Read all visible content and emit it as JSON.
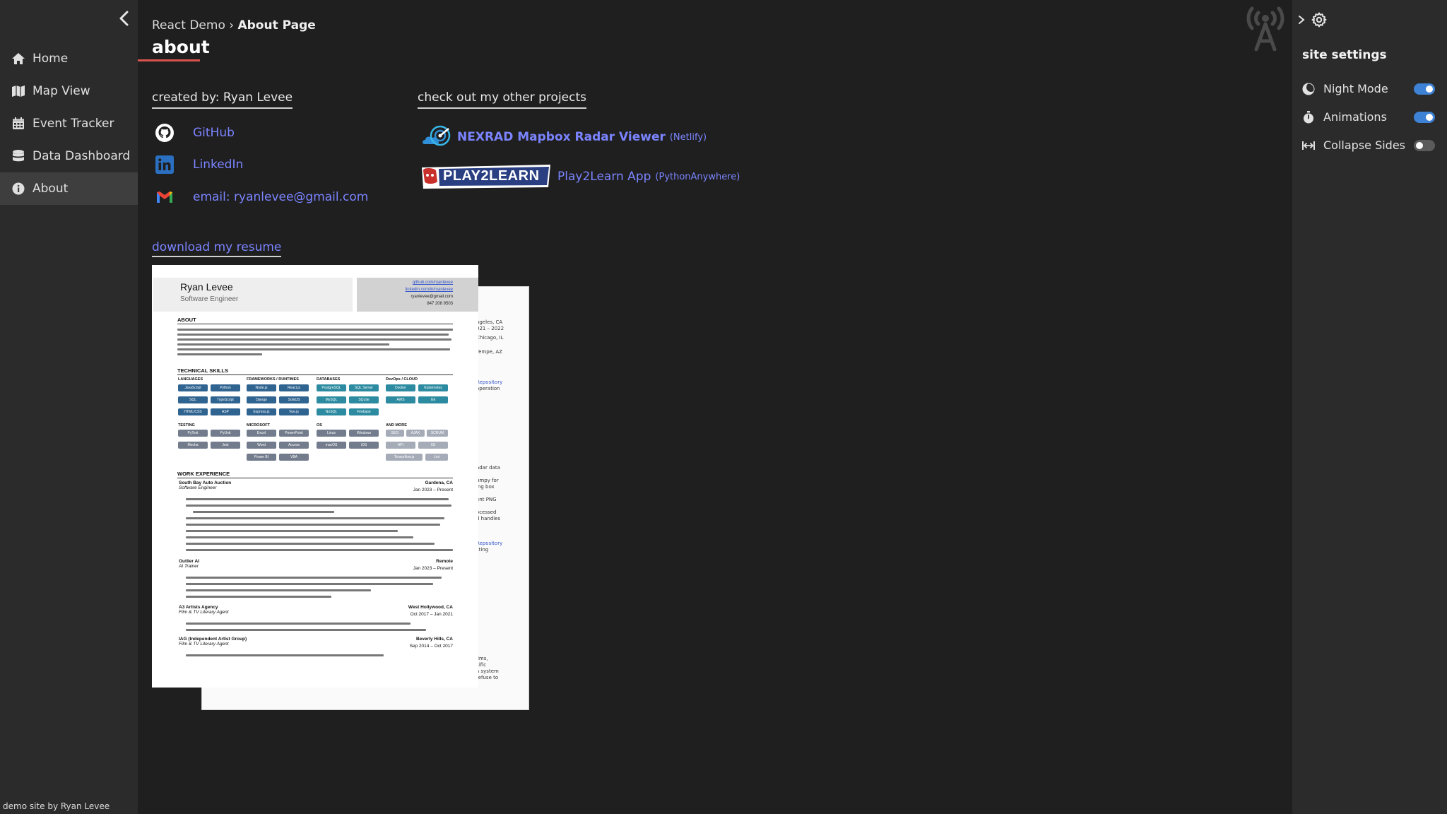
{
  "breadcrumb": {
    "root": "React Demo",
    "separator": " › ",
    "current": "About Page"
  },
  "page_title": "about",
  "sidebar": {
    "items": [
      {
        "label": "Home",
        "icon": "home-icon",
        "active": false
      },
      {
        "label": "Map View",
        "icon": "map-icon",
        "active": false
      },
      {
        "label": "Event Tracker",
        "icon": "calendar-icon",
        "active": false
      },
      {
        "label": "Data Dashboard",
        "icon": "database-icon",
        "active": false
      },
      {
        "label": "About",
        "icon": "info-icon",
        "active": true
      }
    ],
    "footer": "demo site by Ryan Levee"
  },
  "creator": {
    "heading": "created by: Ryan Levee",
    "links": [
      {
        "label": "GitHub",
        "icon": "github-icon"
      },
      {
        "label": "LinkedIn",
        "icon": "linkedin-icon"
      },
      {
        "label": "email: ryanlevee@gmail.com",
        "icon": "gmail-icon"
      }
    ]
  },
  "projects": {
    "heading": "check out my other projects",
    "items": [
      {
        "label": "NEXRAD Mapbox Radar Viewer",
        "host": "(Netlify)",
        "icon": "radar-icon"
      },
      {
        "label": "Play2Learn App",
        "host": "(PythonAnywhere)",
        "logo_text": "PLAY2LEARN"
      }
    ]
  },
  "resume": {
    "download_label": "download my resume",
    "name": "Ryan Levee",
    "role": "Software Engineer",
    "contacts": [
      "github.com/ryanlevee",
      "linkedin.com/in/ryanlevee",
      "ryanlevee@gmail.com",
      "847 208 9503"
    ],
    "sections": {
      "about": "ABOUT",
      "skills": "TECHNICAL SKILLS",
      "work": "WORK EXPERIENCE"
    },
    "skill_groups": [
      {
        "name": "LANGUAGES",
        "items": [
          "JavaScript",
          "Python",
          "SQL",
          "TypeScript",
          "HTML/CSS",
          "ASP"
        ]
      },
      {
        "name": "FRAMEWORKS / RUNTIMES",
        "items": [
          "Node.js",
          "React.js",
          "Django",
          "SolidJS",
          "Express.js",
          "Vue.js"
        ]
      },
      {
        "name": "DATABASES",
        "items": [
          "PostgreSQL",
          "SQL Server",
          "MySQL",
          "SQLite",
          "NoSQL",
          "Firebase"
        ]
      },
      {
        "name": "DevOps / CLOUD",
        "items": [
          "Docker",
          "Kubernetes",
          "AWS",
          "Git"
        ]
      },
      {
        "name": "TESTING",
        "items": [
          "PyTest",
          "PyUnit",
          "Mocha",
          "Jest"
        ]
      },
      {
        "name": "MICROSOFT",
        "items": [
          "Excel",
          "PowerPoint",
          "Word",
          "Access",
          "Power BI",
          "VBA"
        ]
      },
      {
        "name": "OS",
        "items": [
          "Linux",
          "Windows",
          "macOS",
          "iOS"
        ]
      },
      {
        "name": "AND MORE",
        "items": [
          "SEO",
          "AJAX",
          "SCRUM",
          "API",
          "IIS",
          "Tensorflow.js",
          "Lint"
        ]
      }
    ],
    "jobs": [
      {
        "company": "South Bay Auto Auction",
        "location": "Gardena, CA",
        "title": "Software Engineer",
        "dates": "Jan 2023 – Present"
      },
      {
        "company": "Outlier AI",
        "location": "Remote",
        "title": "AI Trainer",
        "dates": "Jan 2023 – Present"
      },
      {
        "company": "A3 Artists Agency",
        "location": "West Hollywood, CA",
        "title": "Film & TV Literary Agent",
        "dates": "Oct 2017 – Jan 2021"
      },
      {
        "company": "IAG (Independent Artist Group)",
        "location": "Beverly Hills, CA",
        "title": "Film & TV Literary Agent",
        "dates": "Sep 2014 – Oct 2017"
      }
    ],
    "back_page_fragments": [
      "ngeles, CA",
      "021 – 2022",
      "Chicago, IL",
      "Tempe, AZ",
      "Repository",
      "operation",
      "adar data",
      "umpy for",
      "ing box",
      "ent PNG",
      "ocessed",
      "d handles",
      "Repository",
      "sting",
      "ilms,",
      "cific",
      "a system",
      "refuse to"
    ]
  },
  "settings": {
    "title": "site settings",
    "options": [
      {
        "label": "Night Mode",
        "icon": "moon-icon",
        "on": true
      },
      {
        "label": "Animations",
        "icon": "stopwatch-icon",
        "on": true
      },
      {
        "label": "Collapse Sides",
        "icon": "collapse-arrows-icon",
        "on": false
      }
    ]
  },
  "colors": {
    "bg": "#1f1f1f",
    "panel": "#2b2b2b",
    "link": "#7b84ff",
    "accent": "#d9534f",
    "toggle_on": "#3e82d6"
  }
}
